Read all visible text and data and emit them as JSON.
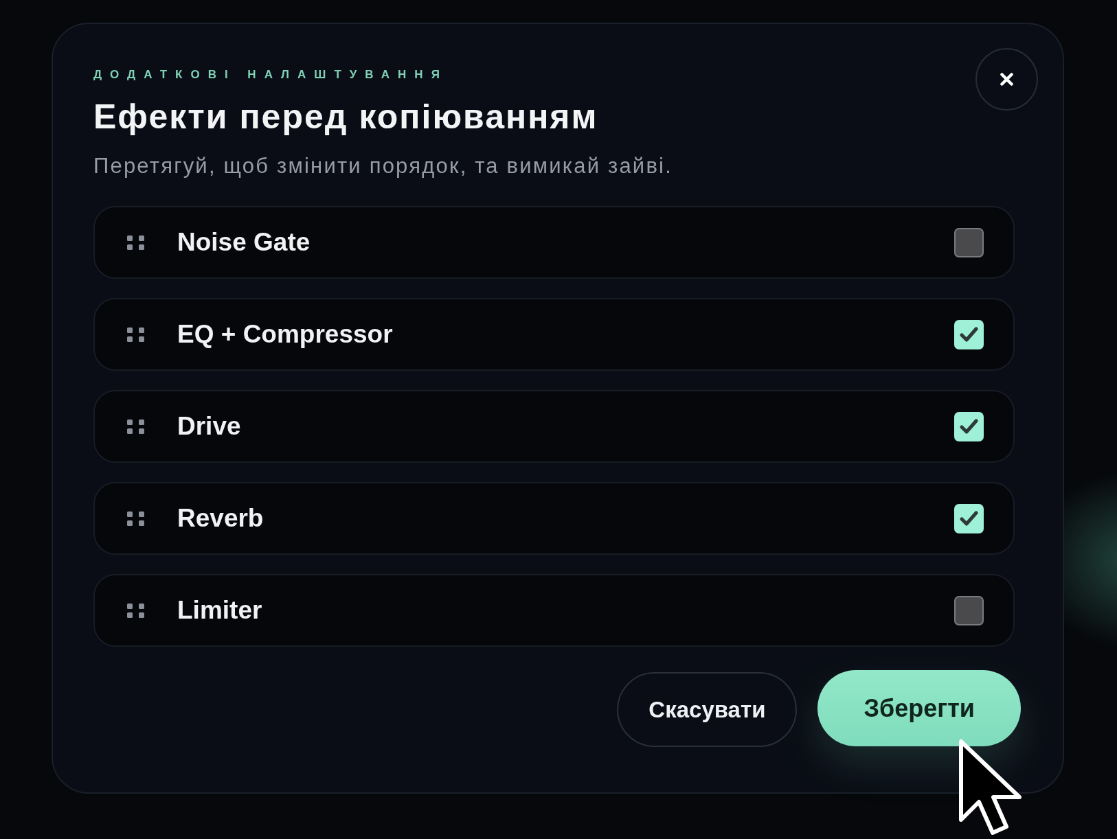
{
  "dialog": {
    "eyebrow": "ДОДАТКОВІ НАЛАШТУВАННЯ",
    "title": "Ефекти перед копіюванням",
    "subtitle": "Перетягуй, щоб змінити порядок, та вимикай зайві.",
    "effects": [
      {
        "name": "Noise Gate",
        "checked": false
      },
      {
        "name": "EQ + Compressor",
        "checked": true
      },
      {
        "name": "Drive",
        "checked": true
      },
      {
        "name": "Reverb",
        "checked": true
      },
      {
        "name": "Limiter",
        "checked": false
      }
    ],
    "buttons": [
      {
        "label": "Скасувати",
        "kind": "secondary"
      },
      {
        "label": "Зберегти",
        "kind": "primary"
      }
    ]
  }
}
